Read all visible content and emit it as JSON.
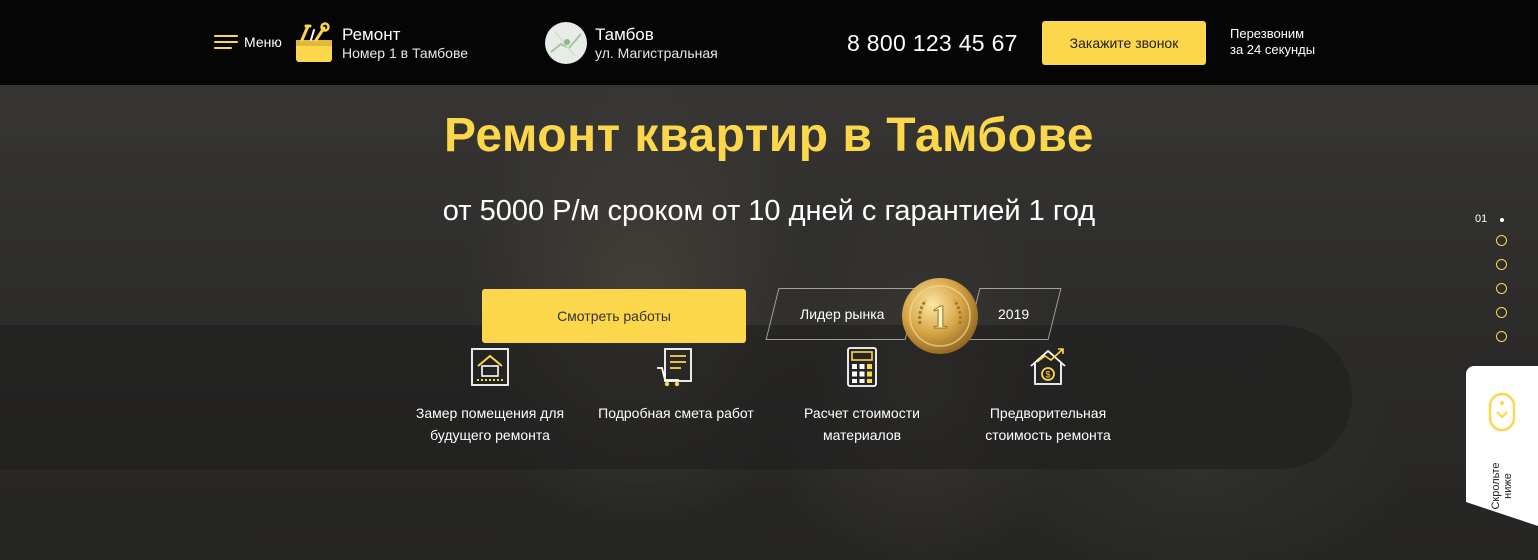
{
  "header": {
    "menu_label": "Меню",
    "logo_title": "Ремонт",
    "logo_subtitle": "Номер 1 в Тамбове",
    "city_name": "Тамбов",
    "city_street": "ул. Магистральная",
    "phone": "8 800 123 45 67",
    "call_button": "Закажите звонок",
    "callback_line1": "Перезвоним",
    "callback_line2": "за 24 секунды"
  },
  "hero": {
    "title": "Ремонт квартир в Тамбове",
    "subtitle": "от 5000 Р/м сроком от 10 дней с гарантией 1 год",
    "works_button": "Смотреть работы",
    "leader_label": "Лидер рынка",
    "leader_number": "1",
    "leader_year": "2019"
  },
  "features": [
    {
      "icon": "house-plan-icon",
      "line1": "Замер помещения для",
      "line2": "будущего ремонта"
    },
    {
      "icon": "estimate-cart-icon",
      "line1": "Подробная смета работ",
      "line2": ""
    },
    {
      "icon": "calculator-icon",
      "line1": "Расчет стоимости",
      "line2": "материалов"
    },
    {
      "icon": "house-price-growth-icon",
      "line1": "Предворительная",
      "line2": "стоимость ремонта"
    }
  ],
  "pager": {
    "current": "01",
    "total_dots": 5
  },
  "scroll_hint": {
    "line1": "Скрольте",
    "line2": "ниже"
  },
  "colors": {
    "accent": "#fcd74b",
    "header_bg": "#050505",
    "text": "#ffffff"
  }
}
